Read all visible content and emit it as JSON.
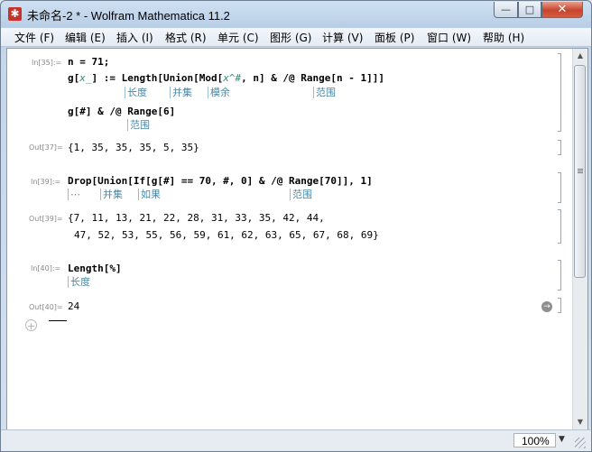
{
  "window": {
    "title": "未命名-2 * - Wolfram Mathematica 11.2",
    "app_icon": "mathematica-spikey-icon",
    "controls": {
      "minimize": "—",
      "maximize": "□",
      "close": "✕"
    }
  },
  "menu": [
    "文件 (F)",
    "编辑 (E)",
    "插入 (I)",
    "格式 (R)",
    "单元 (C)",
    "图形 (G)",
    "计算 (V)",
    "面板 (P)",
    "窗口 (W)",
    "帮助 (H)"
  ],
  "cells": {
    "c1": {
      "label": "In[35]:=",
      "line1": "n = 71;",
      "line2_a": "g[",
      "line2_pat1": "x_",
      "line2_b": "] := Length[Union[Mod[",
      "line2_pat2": "x^#",
      "line2_c": ", n] & /@ Range[n - 1]]]",
      "tips2": {
        "length": "长度",
        "union": "并集",
        "mod": "模余",
        "range": "范围"
      },
      "line3": "g[#] & /@ Range[6]",
      "tips3": {
        "range": "范围"
      }
    },
    "o1": {
      "label": "Out[37]=",
      "text": "{1, 35, 35, 35, 5, 35}"
    },
    "c2": {
      "label": "In[39]:=",
      "line1": "Drop[Union[If[g[#] == 70, #, 0] & /@ Range[70]], 1]",
      "tips": {
        "drop": "⋯",
        "union": "并集",
        "if": "如果",
        "range": "范围"
      }
    },
    "o2": {
      "label": "Out[39]=",
      "line1": "{7, 11, 13, 21, 22, 28, 31, 33, 35, 42, 44,",
      "line2": "47, 52, 53, 55, 56, 59, 61, 62, 63, 65, 67, 68, 69}"
    },
    "c3": {
      "label": "In[40]:=",
      "line1": "Length[%]",
      "tips": {
        "length": "长度"
      }
    },
    "o3": {
      "label": "Out[40]=",
      "text": "24"
    }
  },
  "icons": {
    "new_cell": "+",
    "go": "→",
    "scroll_up": "▲",
    "scroll_down": "▼"
  },
  "status": {
    "zoom": "100%",
    "zoom_arrow": "▼"
  }
}
